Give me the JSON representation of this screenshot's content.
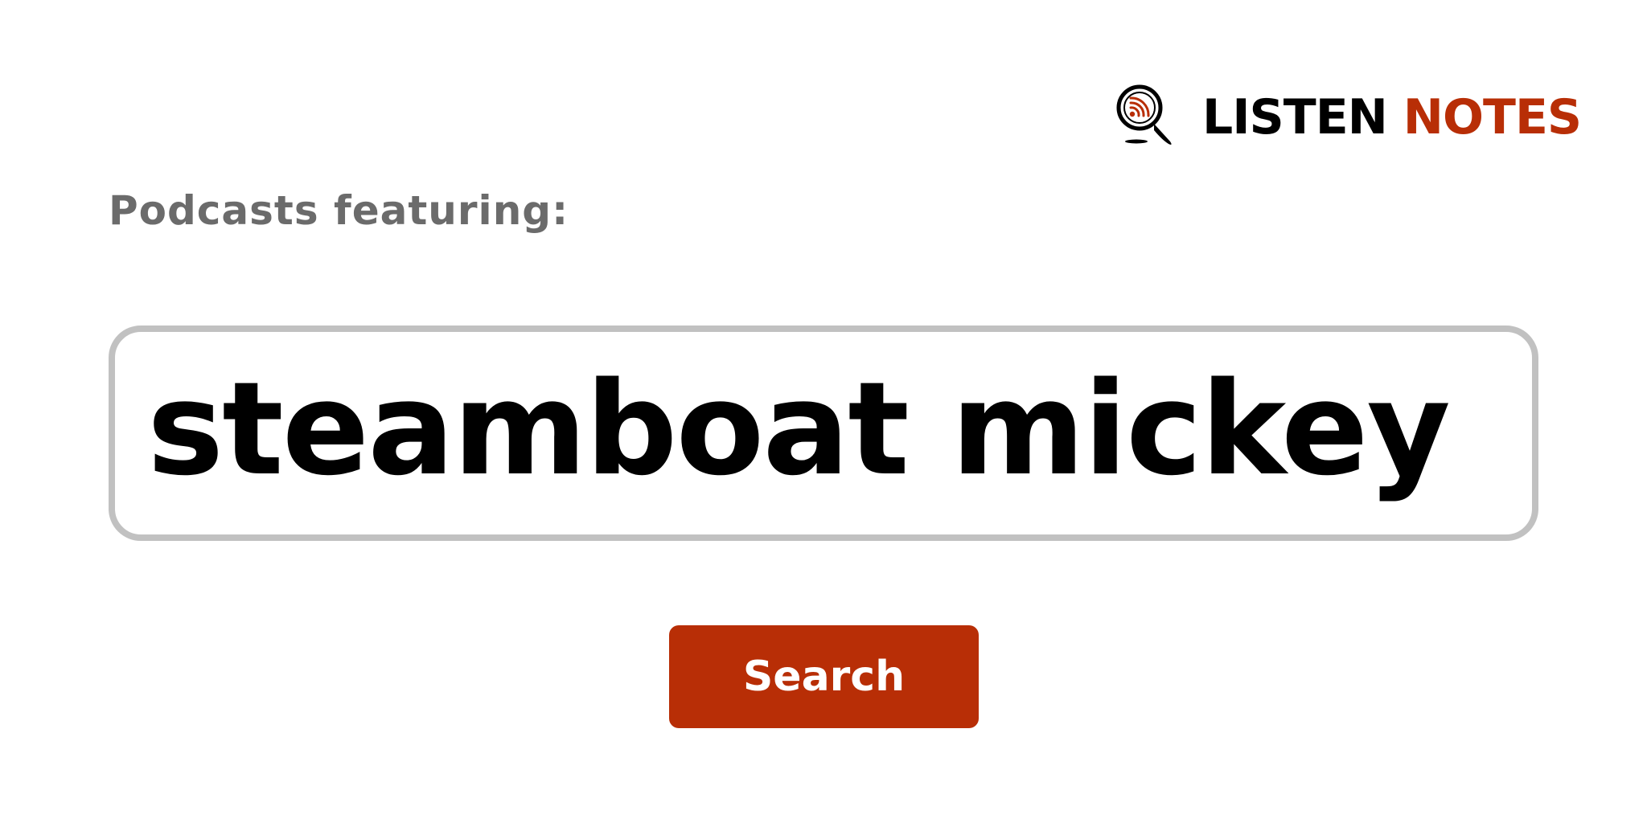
{
  "brand": {
    "name_part1": "LISTEN",
    "name_part2": "NOTES",
    "icon": "magnifier-podcast-icon",
    "primary_color": "#b82e06",
    "text_color": "#000000"
  },
  "prompt": {
    "label": "Podcasts featuring:",
    "color": "#6b6b6b"
  },
  "search": {
    "value": "steamboat mickey",
    "border_color": "#c1c1c1"
  },
  "actions": {
    "search_label": "Search",
    "search_color": "#b82e06"
  }
}
